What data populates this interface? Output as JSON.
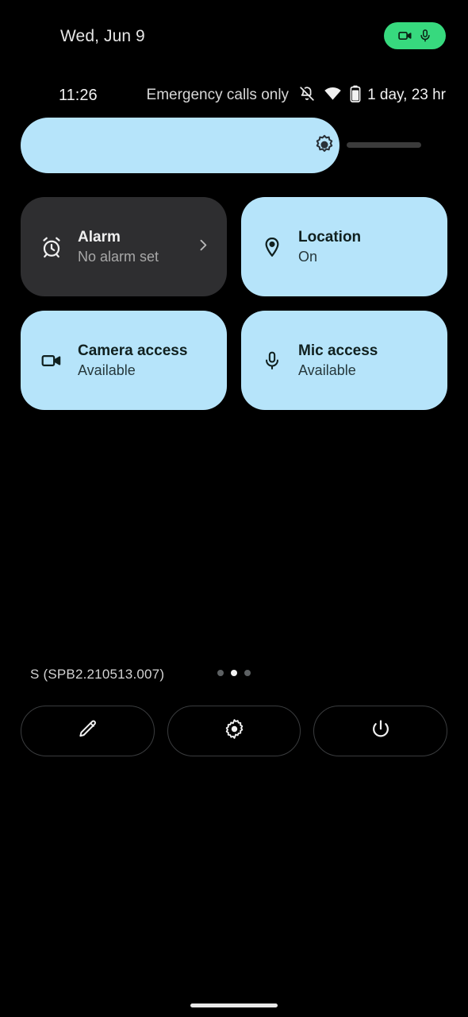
{
  "statusbar": {
    "date": "Wed, Jun 9",
    "time": "11:26",
    "carrier": "Emergency calls only",
    "battery_estimate": "1 day, 23 hr",
    "privacy_chip": {
      "camera_icon": "camera-icon",
      "mic_icon": "mic-icon",
      "color": "#37d97e"
    },
    "icons": {
      "silent": "bell-slash-icon",
      "wifi": "wifi-icon",
      "battery": "battery-icon"
    }
  },
  "brightness": {
    "name": "brightness-slider",
    "icon": "brightness-icon",
    "fill_percent": 80,
    "fill_color": "#b6e4fa",
    "track_color": "#3b3b3b"
  },
  "tiles": [
    {
      "title": "Alarm",
      "subtitle": "No alarm set",
      "icon": "alarm-clock-icon",
      "state": "inactive",
      "has_chevron": true,
      "color": "#2e2e30"
    },
    {
      "title": "Location",
      "subtitle": "On",
      "icon": "location-pin-icon",
      "state": "active",
      "has_chevron": false,
      "color": "#b6e4fa"
    },
    {
      "title": "Camera access",
      "subtitle": "Available",
      "icon": "camera-icon",
      "state": "active",
      "has_chevron": false,
      "color": "#b6e4fa"
    },
    {
      "title": "Mic access",
      "subtitle": "Available",
      "icon": "mic-icon",
      "state": "active",
      "has_chevron": false,
      "color": "#b6e4fa"
    }
  ],
  "footer": {
    "build": "S (SPB2.210513.007)",
    "pages": {
      "total": 3,
      "active_index": 1
    }
  },
  "actions": [
    {
      "name": "edit-button",
      "icon": "pencil-icon"
    },
    {
      "name": "settings-button",
      "icon": "gear-icon"
    },
    {
      "name": "power-button",
      "icon": "power-icon"
    }
  ]
}
